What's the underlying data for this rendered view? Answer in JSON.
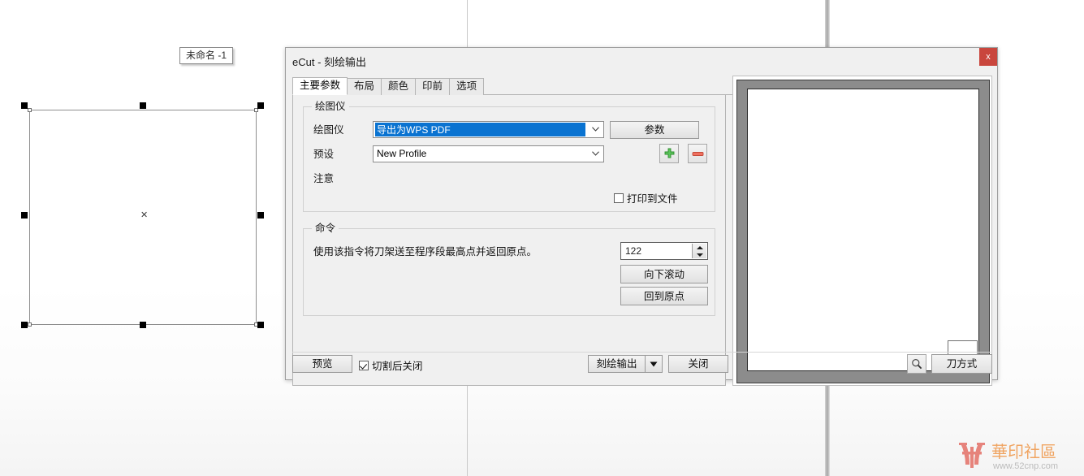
{
  "app": {
    "object_label": "未命名 -1",
    "watermark_text": "華印社區",
    "watermark_url": "www.52cnp.com"
  },
  "dialog": {
    "title": "eCut - 刻绘输出",
    "close_label": "x",
    "tabs": [
      {
        "label": "主要参数",
        "active": true
      },
      {
        "label": "布局",
        "active": false
      },
      {
        "label": "颜色",
        "active": false
      },
      {
        "label": "印前",
        "active": false
      },
      {
        "label": "选项",
        "active": false
      }
    ],
    "plotter_group": {
      "title": "绘图仪",
      "plotter_label": "绘图仪",
      "plotter_value": "导出为WPS PDF",
      "params_button": "参数",
      "preset_label": "预设",
      "preset_value": "New Profile",
      "add_preset_icon": "plus-icon",
      "remove_preset_icon": "minus-icon",
      "note_label": "注意",
      "note_value": "",
      "print_to_file_label": "打印到文件",
      "print_to_file_checked": false
    },
    "command_group": {
      "title": "命令",
      "description": "使用该指令将刀架送至程序段最高点并返回原点。",
      "spin_value": "122",
      "scroll_down_button": "向下滚动",
      "return_home_button": "回到原点"
    },
    "footer": {
      "preview_button": "预览",
      "close_after_cut_label": "切割后关闭",
      "close_after_cut_checked": true,
      "output_button": "刻绘输出",
      "output_dropdown_icon": "chevron-down-icon",
      "close_button": "关闭",
      "zoom_icon": "magnifier-icon",
      "knife_mode_button": "刀方式"
    }
  },
  "colors": {
    "accent_selection": "#0a73d1",
    "close_red": "#c9463d",
    "add_green": "#4caf50",
    "remove_red": "#e8604c",
    "dialog_bg": "#f0f0f0"
  }
}
